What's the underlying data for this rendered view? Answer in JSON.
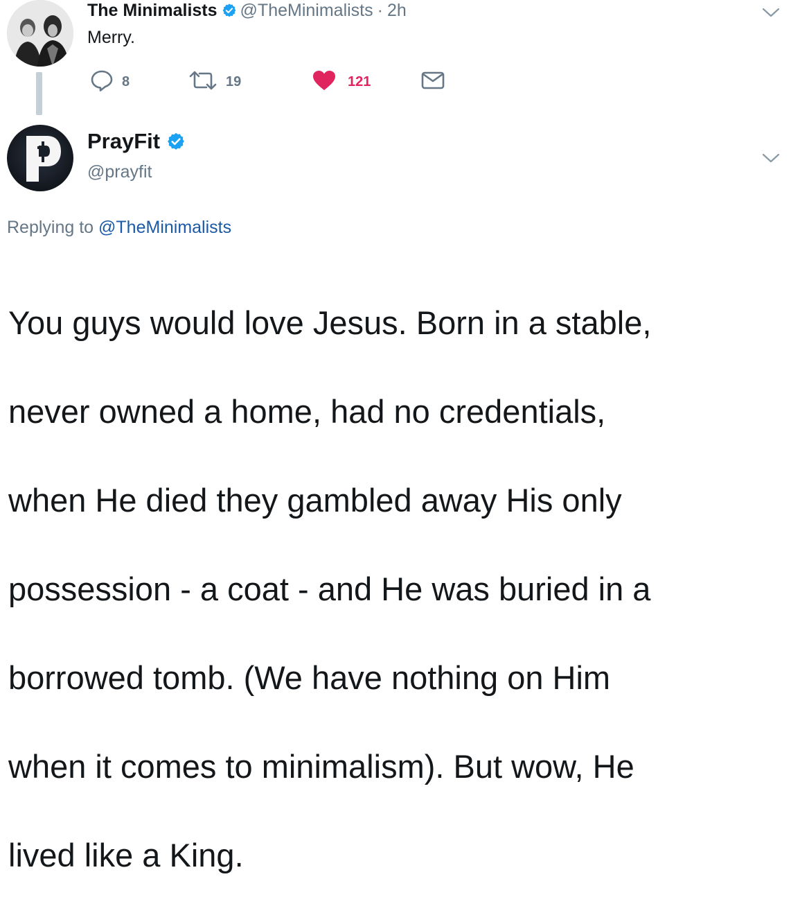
{
  "parent_tweet": {
    "author_name": "The Minimalists",
    "handle": "@TheMinimalists",
    "separator": "·",
    "time": "2h",
    "text": "Merry.",
    "replies": "8",
    "retweets": "19",
    "likes": "121",
    "verified": true,
    "like_color": "#e0245e"
  },
  "reply_tweet": {
    "author_name": "PrayFit",
    "handle": "@prayfit",
    "verified": true,
    "replying_prefix": "Replying to",
    "replying_to": "@TheMinimalists",
    "text_lines": [
      "You guys would love Jesus. Born in a stable,",
      "never owned a home, had no credentials,",
      "when He died they gambled away His only",
      "possession - a coat - and He was buried in a",
      "borrowed tomb. (We have nothing on Him",
      "when it comes to minimalism). But wow, He",
      "lived like a King."
    ]
  },
  "icons": {
    "reply": "reply-bubble-icon",
    "retweet": "retweet-icon",
    "like": "heart-icon",
    "dm": "envelope-icon",
    "menu": "chevron-down-icon",
    "verified": "verified-badge-icon"
  },
  "colors": {
    "verified_blue": "#1da1f2",
    "muted_text": "#657786",
    "link": "#1b5aa6",
    "thread_line": "#c4cfd6"
  }
}
